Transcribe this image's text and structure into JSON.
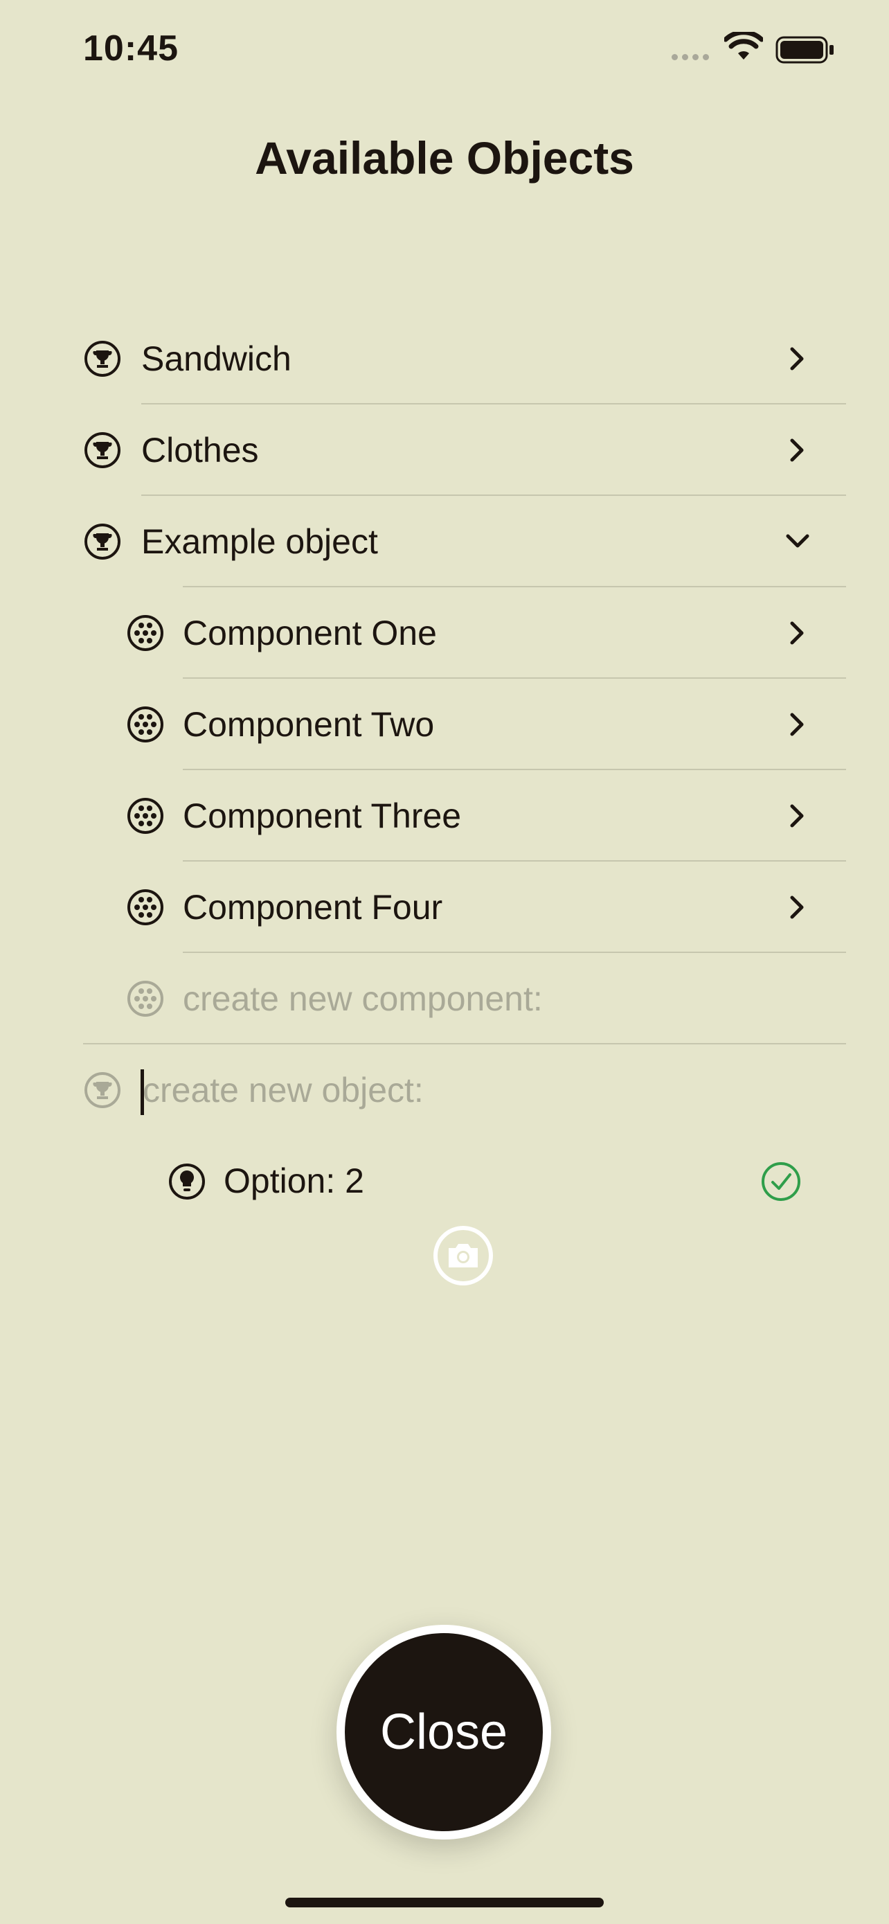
{
  "status": {
    "time": "10:45"
  },
  "title": "Available Objects",
  "objects": [
    {
      "label": "Sandwich",
      "expanded": false
    },
    {
      "label": "Clothes",
      "expanded": false
    },
    {
      "label": "Example object",
      "expanded": true
    }
  ],
  "components": [
    {
      "label": "Component One"
    },
    {
      "label": "Component Two"
    },
    {
      "label": "Component Three"
    },
    {
      "label": "Component Four"
    }
  ],
  "new_component_placeholder": "create new component:",
  "new_object_placeholder": "create new object:",
  "option": {
    "label": "Option: 2",
    "status": "selected"
  },
  "close_label": "Close",
  "colors": {
    "background": "#e5e5cb",
    "text": "#1c1510",
    "placeholder": "#a9a997",
    "check": "#2f9e4a",
    "separator": "#c6c6ae"
  },
  "icons": {
    "object": "trophy-icon",
    "component": "dots-grid-icon",
    "option": "lightbulb-icon",
    "disclosure": "chevron-right-icon",
    "expanded": "chevron-down-icon",
    "camera": "camera-icon",
    "check": "checkmark-circle-icon"
  }
}
